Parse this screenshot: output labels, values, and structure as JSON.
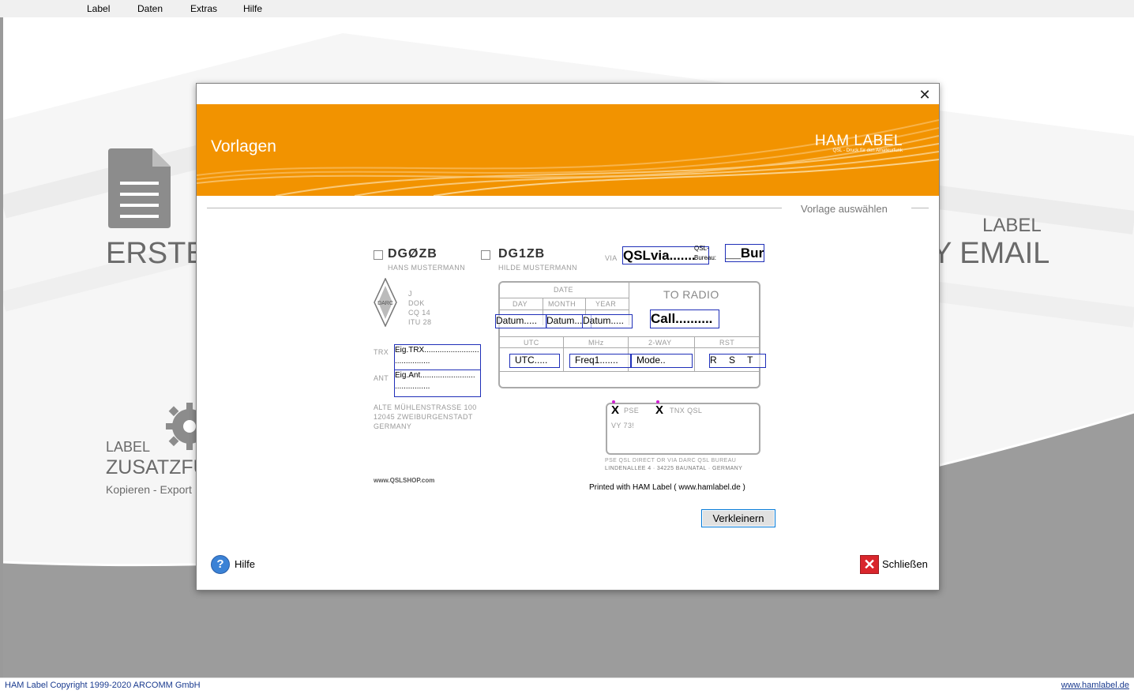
{
  "menu": [
    "Label",
    "Daten",
    "Extras",
    "Hilfe"
  ],
  "background": {
    "erste": "ERSTE",
    "label_right": "LABEL",
    "email": "Y EMAIL",
    "label_left": "LABEL",
    "zusatz": "ZUSATZFU",
    "kopieren": "Kopieren - Export"
  },
  "status": {
    "copyright": "HAM Label Copyright 1999-2020 ARCOMM GmbH",
    "website": "www.hamlabel.de"
  },
  "dialog": {
    "banner_title": "Vorlagen",
    "brand": "HAM LABEL",
    "brand_sub": "QSL - Druck für den Amateurfunk",
    "section_label": "Vorlage auswählen",
    "verkleinern": "Verkleinern",
    "hilfe": "Hilfe",
    "schliessen": "Schließen"
  },
  "card": {
    "call1": "DGØZB",
    "name1": "HANS MUSTERMANN",
    "call2": "DG1ZB",
    "name2": "HILDE MUSTERMANN",
    "via": "VIA",
    "qslvia": "QSLvia.......",
    "qsl_bureau_1": "QSL-",
    "qsl_bureau_2": "Bureau:",
    "bur": "__Bur",
    "info_lines": [
      "J",
      "DOK",
      "CQ 14",
      "ITU 28"
    ],
    "trx": "TRX",
    "ant": "ANT",
    "eig_trx": "Eig.TRX.........................",
    "eig_trx2": "................",
    "eig_ant": "Eig.Ant.........................",
    "eig_ant2": "................",
    "address": [
      "ALTE MÜHLENSTRASSE 100",
      "12045 ZWEIBURGENSTADT",
      "GERMANY"
    ],
    "date": "DATE",
    "day": "DAY",
    "month": "MONTH",
    "year": "YEAR",
    "to_radio": "TO RADIO",
    "datum1": "Datum.....",
    "datum2": "Datum.....",
    "datum3": "Datum.....",
    "call_ph": "Call..........",
    "utc": "UTC",
    "mhz": "MHz",
    "twoway": "2-WAY",
    "rst": "RST",
    "utc_ph": "UTC.....",
    "freq_ph": "Freq1.......",
    "mode_ph": "Mode..",
    "rst_ph": "R S T r",
    "pse": "PSE",
    "tnx": "TNX QSL",
    "mark": "X",
    "vy73": "VY 73!",
    "pse_line": "PSE QSL DIRECT OR VIA DARC QSL BUREAU",
    "pse_addr": "LINDENALLEE 4 · 34225 BAUNATAL · GERMANY",
    "shop": "www.QSLSHOP.com",
    "printed": "Printed with HAM Label ( www.hamlabel.de )"
  }
}
